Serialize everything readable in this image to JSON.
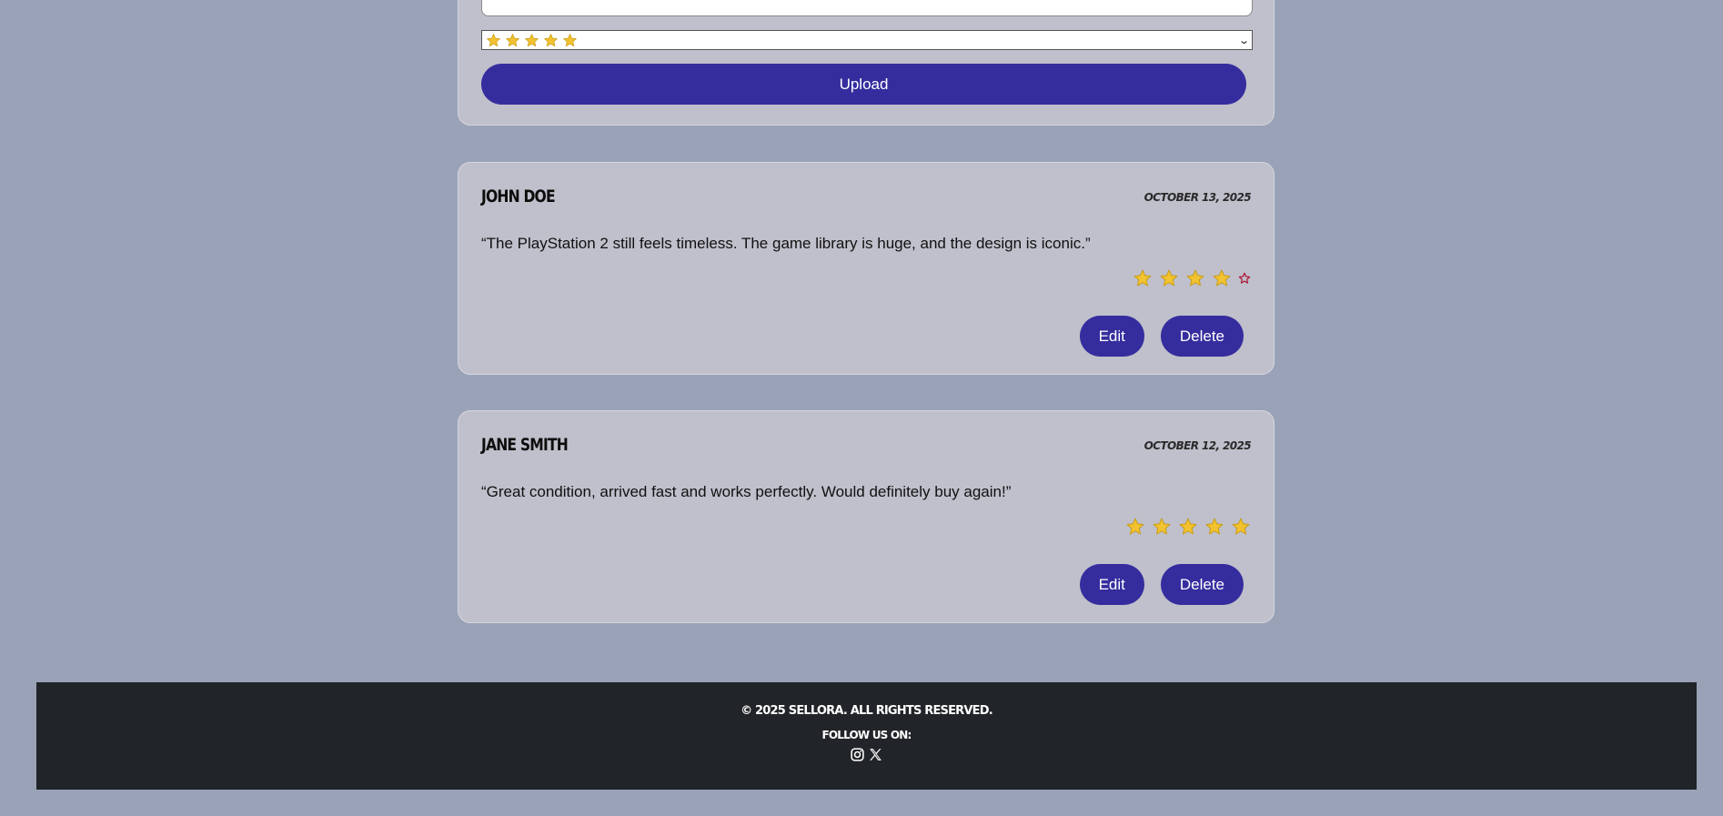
{
  "upload_form": {
    "rating_select": {
      "selected_value": "⭐⭐⭐⭐⭐",
      "selected_stars": 5
    },
    "upload_label": "Upload"
  },
  "reviews": [
    {
      "name": "John Doe",
      "date": "October 13, 2025",
      "text": "“The PlayStation 2 still feels timeless. The game library is huge, and the design is iconic.”",
      "rating": 4,
      "rating_max": 5,
      "edit_label": "Edit",
      "delete_label": "Delete"
    },
    {
      "name": "Jane Smith",
      "date": "October 12, 2025",
      "text": "“Great condition, arrived fast and works perfectly. Would definitely buy again!”",
      "rating": 5,
      "rating_max": 5,
      "edit_label": "Edit",
      "delete_label": "Delete"
    }
  ],
  "footer": {
    "copyright": "© 2025 Sellora. All rights reserved.",
    "follow_label": "Follow us on:",
    "social_icons": [
      "instagram-icon",
      "x-twitter-icon"
    ]
  },
  "colors": {
    "background": "#9aa2b8",
    "card": "#bfc0cb",
    "accent": "#352d9e",
    "footer": "#212428",
    "star_fill": "#f2c230",
    "empty_star_outline": "#b01030"
  }
}
